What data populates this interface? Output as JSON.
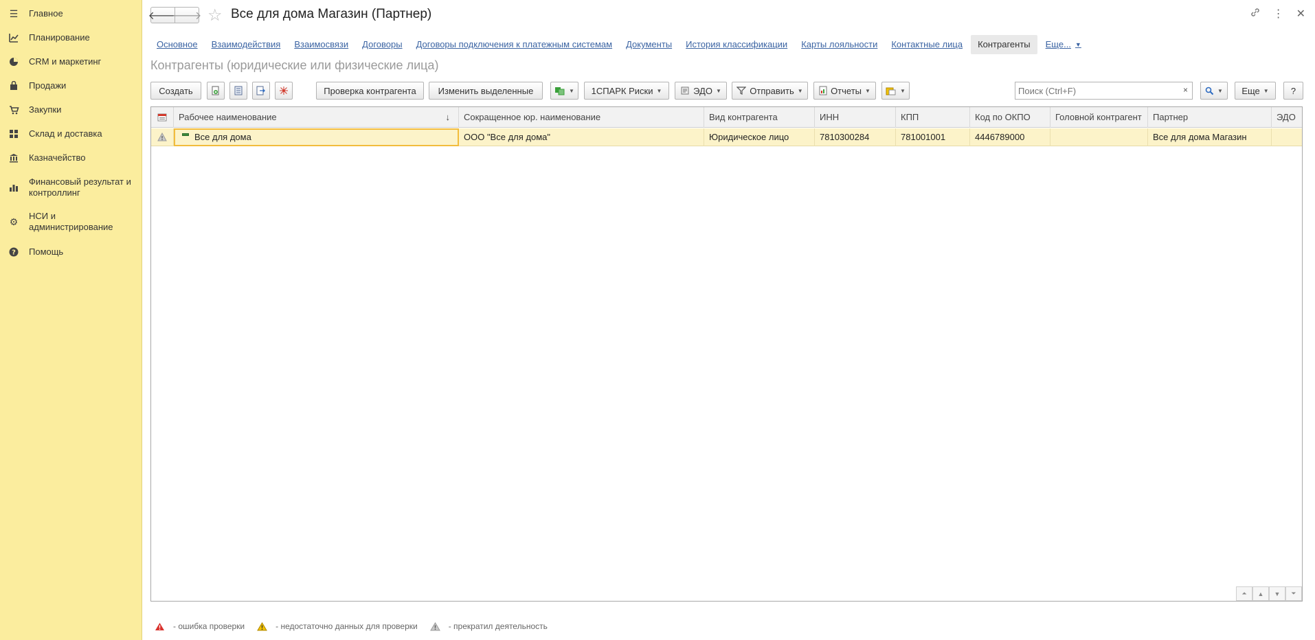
{
  "sidebar": {
    "items": [
      {
        "label": "Главное",
        "icon": "hamburger-icon"
      },
      {
        "label": "Планирование",
        "icon": "planning-icon"
      },
      {
        "label": "CRM и маркетинг",
        "icon": "pie-chart-icon"
      },
      {
        "label": "Продажи",
        "icon": "bag-icon"
      },
      {
        "label": "Закупки",
        "icon": "cart-icon"
      },
      {
        "label": "Склад и доставка",
        "icon": "warehouse-grid-icon"
      },
      {
        "label": "Казначейство",
        "icon": "treasury-icon"
      },
      {
        "label": "Финансовый результат и контроллинг",
        "icon": "bar-chart-icon"
      },
      {
        "label": "НСИ и администрирование",
        "icon": "gear-icon"
      },
      {
        "label": "Помощь",
        "icon": "help-icon"
      }
    ]
  },
  "header": {
    "title": "Все для дома Магазин (Партнер)"
  },
  "tabs": [
    {
      "label": "Основное",
      "active": false
    },
    {
      "label": "Взаимодействия",
      "active": false
    },
    {
      "label": "Взаимосвязи",
      "active": false
    },
    {
      "label": "Договоры",
      "active": false
    },
    {
      "label": "Договоры подключения к платежным системам",
      "active": false
    },
    {
      "label": "Документы",
      "active": false
    },
    {
      "label": "История классификации",
      "active": false
    },
    {
      "label": "Карты лояльности",
      "active": false
    },
    {
      "label": "Контактные лица",
      "active": false
    },
    {
      "label": "Контрагенты",
      "active": true
    }
  ],
  "tabs_more": "Еще...",
  "section_title": "Контрагенты (юридические или физические лица)",
  "toolbar": {
    "create": "Создать",
    "check": "Проверка контрагента",
    "edit_selected": "Изменить выделенные",
    "spark": "1СПАРК Риски",
    "edo": "ЭДО",
    "send": "Отправить",
    "reports": "Отчеты",
    "more": "Еще",
    "help": "?",
    "search_placeholder": "Поиск (Ctrl+F)",
    "search_clear": "×"
  },
  "table": {
    "columns": [
      "Рабочее наименование",
      "Сокращенное юр. наименование",
      "Вид контрагента",
      "ИНН",
      "КПП",
      "Код по ОКПО",
      "Головной контрагент",
      "Партнер",
      "ЭДО"
    ],
    "rows": [
      {
        "name": "Все для дома",
        "short_name": "ООО \"Все для дома\"",
        "type": "Юридическое лицо",
        "inn": "7810300284",
        "kpp": "781001001",
        "okpo": "4446789000",
        "head": "",
        "partner": "Все для дома Магазин",
        "edo": ""
      }
    ]
  },
  "legend": {
    "error": "- ошибка проверки",
    "insufficient": "- недостаточно данных для проверки",
    "ceased": "- прекратил деятельность"
  },
  "colors": {
    "sidebar_bg": "#fbed9e",
    "link": "#3b64a3",
    "row_selected": "#fcf3c9",
    "cell_focus": "#f2bc3c",
    "error": "#d9312c",
    "warning": "#f2c200",
    "ceased": "#9a9a9a"
  }
}
